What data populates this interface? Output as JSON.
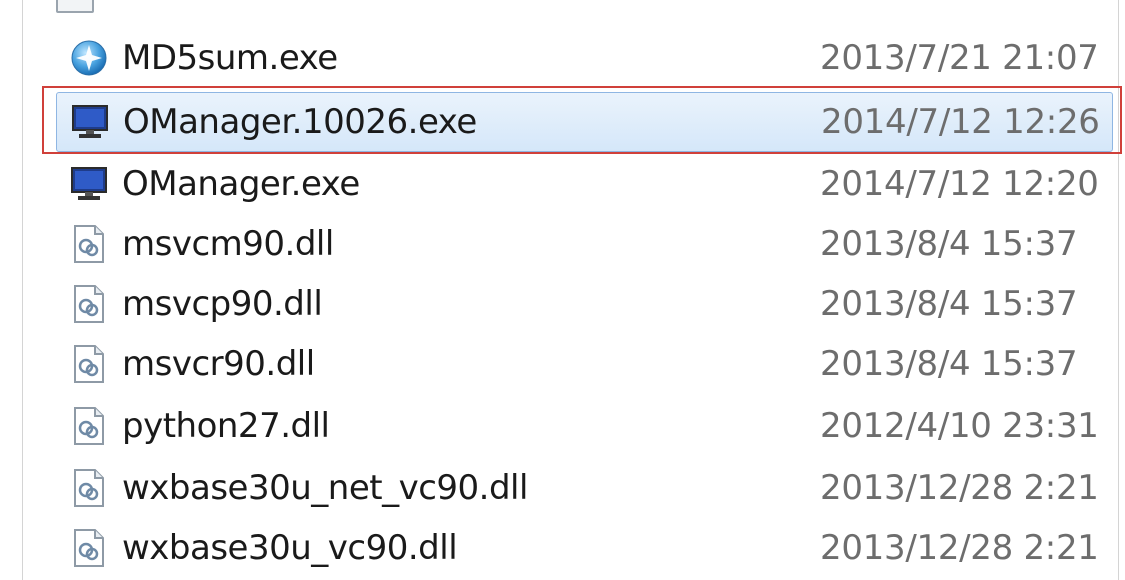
{
  "files": [
    {
      "name": "MD5sum.exe",
      "date": "2013/7/21 21:07",
      "icon": "md5-app-icon",
      "selected": false
    },
    {
      "name": "OManager.10026.exe",
      "date": "2014/7/12 12:26",
      "icon": "monitor-app-icon",
      "selected": true
    },
    {
      "name": "OManager.exe",
      "date": "2014/7/12 12:20",
      "icon": "monitor-app-icon",
      "selected": false
    },
    {
      "name": "msvcm90.dll",
      "date": "2013/8/4 15:37",
      "icon": "dll-file-icon",
      "selected": false
    },
    {
      "name": "msvcp90.dll",
      "date": "2013/8/4 15:37",
      "icon": "dll-file-icon",
      "selected": false
    },
    {
      "name": "msvcr90.dll",
      "date": "2013/8/4 15:37",
      "icon": "dll-file-icon",
      "selected": false
    },
    {
      "name": "python27.dll",
      "date": "2012/4/10 23:31",
      "icon": "dll-file-icon",
      "selected": false
    },
    {
      "name": "wxbase30u_net_vc90.dll",
      "date": "2013/12/28 2:21",
      "icon": "dll-file-icon",
      "selected": false
    },
    {
      "name": "wxbase30u_vc90.dll",
      "date": "2013/12/28 2:21",
      "icon": "dll-file-icon",
      "selected": false
    }
  ],
  "colors": {
    "selection_bg": "#d5e7f9",
    "selection_border": "#8fb6e3",
    "highlight_box": "#d0403a",
    "date_text": "#6d6d6d"
  }
}
